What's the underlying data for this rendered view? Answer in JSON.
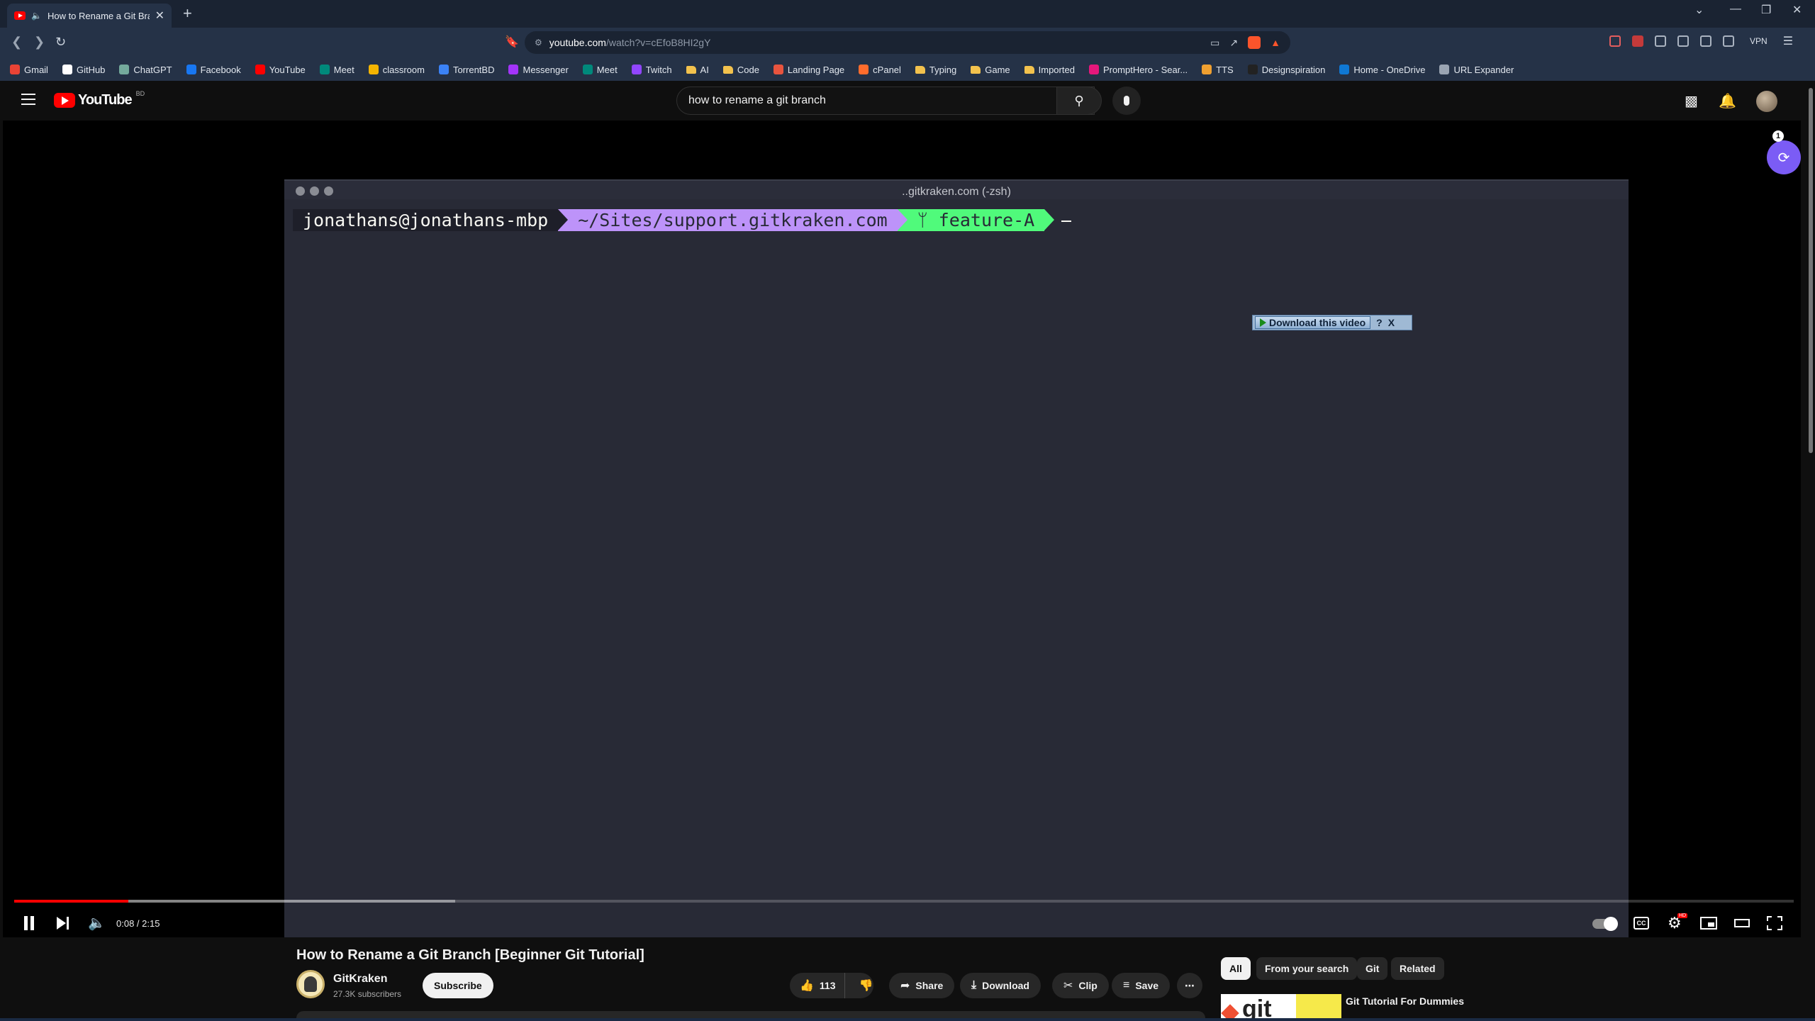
{
  "browser": {
    "tab_title": "How to Rename a Git Branch",
    "url_host": "youtube.com",
    "url_path": "/watch?v=cEfoB8HI2gY",
    "vpn_label": "VPN",
    "bookmarks": [
      {
        "label": "Gmail",
        "icon": "gmail-icon",
        "color": "#ea4335"
      },
      {
        "label": "GitHub",
        "icon": "github-icon",
        "color": "#ffffff"
      },
      {
        "label": "ChatGPT",
        "icon": "chatgpt-icon",
        "color": "#74aa9c"
      },
      {
        "label": "Facebook",
        "icon": "facebook-icon",
        "color": "#1877f2"
      },
      {
        "label": "YouTube",
        "icon": "youtube-icon",
        "color": "#ff0000"
      },
      {
        "label": "Meet",
        "icon": "meet-icon",
        "color": "#00897b"
      },
      {
        "label": "classroom",
        "icon": "classroom-icon",
        "color": "#f4b400"
      },
      {
        "label": "TorrentBD",
        "icon": "torrentbd-icon",
        "color": "#3b82f6"
      },
      {
        "label": "Messenger",
        "icon": "messenger-icon",
        "color": "#a334fa"
      },
      {
        "label": "Meet",
        "icon": "meet-icon",
        "color": "#00897b"
      },
      {
        "label": "Twitch",
        "icon": "twitch-icon",
        "color": "#9146ff"
      },
      {
        "label": "AI",
        "icon": "folder-icon",
        "color": "#f3c24d"
      },
      {
        "label": "Code",
        "icon": "folder-icon",
        "color": "#f3c24d"
      },
      {
        "label": "Landing Page",
        "icon": "landing-page-icon",
        "color": "#e8543e"
      },
      {
        "label": "cPanel",
        "icon": "cpanel-icon",
        "color": "#ff6c2c"
      },
      {
        "label": "Typing",
        "icon": "folder-icon",
        "color": "#f3c24d"
      },
      {
        "label": "Game",
        "icon": "folder-icon",
        "color": "#f3c24d"
      },
      {
        "label": "Imported",
        "icon": "folder-icon",
        "color": "#f3c24d"
      },
      {
        "label": "PromptHero - Sear...",
        "icon": "prompthero-icon",
        "color": "#e5177b"
      },
      {
        "label": "TTS",
        "icon": "tts-icon",
        "color": "#f0a030"
      },
      {
        "label": "Designspiration",
        "icon": "designspiration-icon",
        "color": "#222222"
      },
      {
        "label": "Home - OneDrive",
        "icon": "onedrive-icon",
        "color": "#0f78d4"
      },
      {
        "label": "URL Expander",
        "icon": "url-expander-icon",
        "color": "#9aa4b2"
      }
    ]
  },
  "youtube": {
    "logo_text": "YouTube",
    "logo_region": "BD",
    "search_value": "how to rename a git branch"
  },
  "player": {
    "terminal_title": "..gitkraken.com (-zsh)",
    "prompt_user": "jonathans@jonathans-mbp",
    "prompt_path": "~/Sites/support.gitkraken.com",
    "prompt_branch": "ᛘ feature-A",
    "download_widget": {
      "label": "Download this video",
      "help": "?",
      "close": "X"
    },
    "time_display": "0:08 / 2:15",
    "progress_played_fraction": 0.064,
    "progress_buffered_fraction": 0.248,
    "settings_badge": "HD",
    "cc_label": "CC",
    "side_badge": "1"
  },
  "video": {
    "title": "How to Rename a Git Branch [Beginner Git Tutorial]",
    "channel": "GitKraken",
    "subscribers": "27.3K subscribers",
    "subscribe_label": "Subscribe",
    "likes": "113",
    "share_label": "Share",
    "download_label": "Download",
    "clip_label": "Clip",
    "save_label": "Save"
  },
  "related": {
    "chips": [
      "All",
      "From your search",
      "Git",
      "Related"
    ],
    "first_title": "Git Tutorial For Dummies",
    "first_thumb_text": "git"
  }
}
